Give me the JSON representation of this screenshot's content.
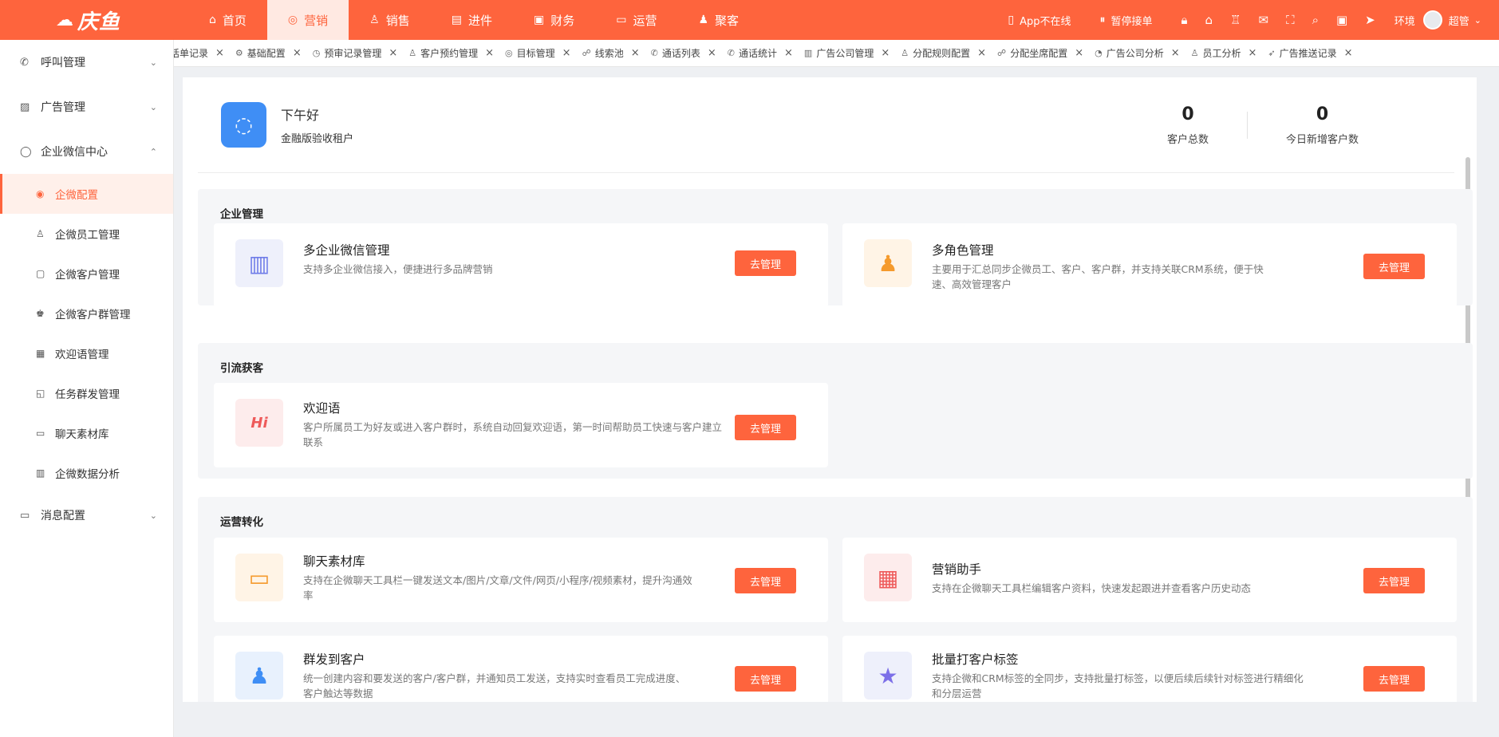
{
  "brand": {
    "logo_text": "庆鱼",
    "logo_mark": "☁",
    "accent": "#fe643d"
  },
  "topnav": {
    "items": [
      {
        "label": "首页",
        "icon": "home-icon",
        "glyph": "⌂"
      },
      {
        "label": "营销",
        "icon": "marketing-icon",
        "glyph": "◎"
      },
      {
        "label": "销售",
        "icon": "sales-icon",
        "glyph": "♙"
      },
      {
        "label": "进件",
        "icon": "document-icon",
        "glyph": "▤"
      },
      {
        "label": "财务",
        "icon": "finance-icon",
        "glyph": "▣"
      },
      {
        "label": "运营",
        "icon": "operations-icon",
        "glyph": "▭"
      },
      {
        "label": "聚客",
        "icon": "customers-icon",
        "glyph": "♟"
      }
    ],
    "active_index": 1
  },
  "topright": {
    "app_status": "App不在线",
    "pause": "暂停接单",
    "env": "环境",
    "user": "超管"
  },
  "sidebar": {
    "groups": [
      {
        "label": "呼叫管理",
        "icon": "phone-icon",
        "glyph": "✆",
        "chevron": "⌄"
      },
      {
        "label": "广告管理",
        "icon": "ad-icon",
        "glyph": "▨",
        "chevron": "⌄"
      },
      {
        "label": "企业微信中心",
        "icon": "chat-icon",
        "glyph": "◯",
        "chevron": "⌃"
      }
    ],
    "subs": [
      {
        "label": "企微配置",
        "icon": "config-icon",
        "glyph": "◉"
      },
      {
        "label": "企微员工管理",
        "icon": "staff-icon",
        "glyph": "♙"
      },
      {
        "label": "企微客户管理",
        "icon": "customer-icon",
        "glyph": "▢"
      },
      {
        "label": "企微客户群管理",
        "icon": "group-icon",
        "glyph": "♚"
      },
      {
        "label": "欢迎语管理",
        "icon": "welcome-icon",
        "glyph": "▦"
      },
      {
        "label": "任务群发管理",
        "icon": "task-icon",
        "glyph": "◱"
      },
      {
        "label": "聊天素材库",
        "icon": "monitor-icon",
        "glyph": "▭"
      },
      {
        "label": "企微数据分析",
        "icon": "analytics-icon",
        "glyph": "▥"
      }
    ],
    "last_group": {
      "label": "消息配置",
      "icon": "message-icon",
      "glyph": "▭",
      "chevron": "⌄"
    }
  },
  "tabs": [
    {
      "label": "话单记录",
      "glyph": ""
    },
    {
      "label": "基础配置",
      "glyph": "⚙"
    },
    {
      "label": "预审记录管理",
      "glyph": "◷"
    },
    {
      "label": "客户预约管理",
      "glyph": "♙"
    },
    {
      "label": "目标管理",
      "glyph": "◎"
    },
    {
      "label": "线索池",
      "glyph": "☍"
    },
    {
      "label": "通话列表",
      "glyph": "✆"
    },
    {
      "label": "通话统计",
      "glyph": "✆"
    },
    {
      "label": "广告公司管理",
      "glyph": "▥"
    },
    {
      "label": "分配规则配置",
      "glyph": "♙"
    },
    {
      "label": "分配坐席配置",
      "glyph": "☍"
    },
    {
      "label": "广告公司分析",
      "glyph": "◔"
    },
    {
      "label": "员工分析",
      "glyph": "♙"
    },
    {
      "label": "广告推送记录",
      "glyph": "➶"
    }
  ],
  "tab_close": "×",
  "welcome": {
    "greeting": "下午好",
    "tenant": "金融版验收租户",
    "stats": [
      {
        "value": "0",
        "label": "客户总数"
      },
      {
        "value": "0",
        "label": "今日新增客户数"
      }
    ]
  },
  "sections": [
    {
      "title": "企业管理",
      "cards": [
        {
          "title": "多企业微信管理",
          "desc": "支持多企业微信接入，便捷进行多品牌营销",
          "button": "去管理",
          "icon": "enterprise-icon",
          "glyph": "▥",
          "bg": "#eef0fb",
          "fg": "#6f7ce8"
        },
        {
          "title": "多角色管理",
          "desc": "主要用于汇总同步企微员工、客户、客户群，并支持关联CRM系统，便于快速、高效管理客户",
          "button": "去管理",
          "icon": "roles-icon",
          "glyph": "♟",
          "bg": "#fff4e6",
          "fg": "#f59a2c"
        }
      ]
    },
    {
      "title": "引流获客",
      "cards": [
        {
          "title": "欢迎语",
          "desc": "客户所属员工为好友或进入客户群时，系统自动回复欢迎语，第一时间帮助员工快速与客户建立联系",
          "button": "去管理",
          "icon": "hi-icon",
          "glyph": "Hi",
          "bg": "#fdecec",
          "fg": "#ee5a5a"
        }
      ]
    },
    {
      "title": "运营转化",
      "cards": [
        {
          "title": "聊天素材库",
          "desc": "支持在企微聊天工具栏一键发送文本/图片/文章/文件/网页/小程序/视频素材，提升沟通效率",
          "button": "去管理",
          "icon": "material-icon",
          "glyph": "▭",
          "bg": "#fff4e6",
          "fg": "#f59a2c"
        },
        {
          "title": "营销助手",
          "desc": "支持在企微聊天工具栏编辑客户资料，快速发起跟进并查看客户历史动态",
          "button": "去管理",
          "icon": "calendar-icon",
          "glyph": "▦",
          "bg": "#fdecec",
          "fg": "#ee5a5a"
        },
        {
          "title": "群发到客户",
          "desc": "统一创建内容和要发送的客户/客户群，并通知员工发送，支持实时查看员工完成进度、客户触达等数据",
          "button": "去管理",
          "icon": "broadcast-icon",
          "glyph": "♟",
          "bg": "#e8f1fd",
          "fg": "#3f8ef5"
        },
        {
          "title": "批量打客户标签",
          "desc": "支持企微和CRM标签的全同步，支持批量打标签，以便后续后续针对标签进行精细化和分层运营",
          "button": "去管理",
          "icon": "tag-icon",
          "glyph": "★",
          "bg": "#eef0fb",
          "fg": "#7c6fe8"
        }
      ]
    }
  ]
}
